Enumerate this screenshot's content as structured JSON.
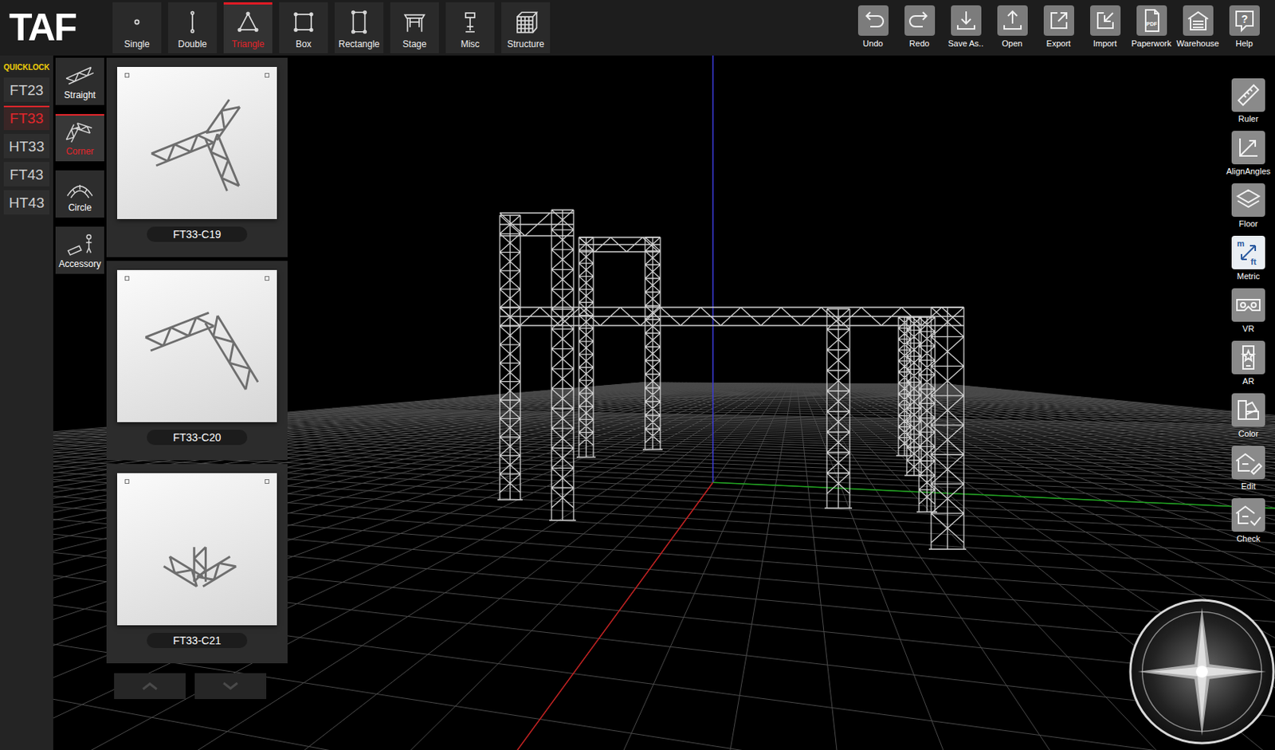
{
  "logo": {
    "text": "TAF"
  },
  "toolbar": {
    "tools": [
      {
        "label": "Single",
        "selected": false
      },
      {
        "label": "Double",
        "selected": false
      },
      {
        "label": "Triangle",
        "selected": true
      },
      {
        "label": "Box",
        "selected": false
      },
      {
        "label": "Rectangle",
        "selected": false
      },
      {
        "label": "Stage",
        "selected": false
      },
      {
        "label": "Misc",
        "selected": false
      },
      {
        "label": "Structure",
        "selected": false
      }
    ],
    "actions": [
      {
        "label": "Undo"
      },
      {
        "label": "Redo"
      },
      {
        "label": "Save As.."
      },
      {
        "label": "Open"
      },
      {
        "label": "Export"
      },
      {
        "label": "Import"
      },
      {
        "label": "Paperwork",
        "icon_text": "PDF"
      },
      {
        "label": "Warehouse"
      },
      {
        "label": "Help",
        "icon_text": "?"
      }
    ]
  },
  "quicklock": {
    "title": "QUICKLOCK",
    "series": [
      {
        "label": "FT23",
        "selected": false
      },
      {
        "label": "FT33",
        "selected": true
      },
      {
        "label": "HT33",
        "selected": false
      },
      {
        "label": "FT43",
        "selected": false
      },
      {
        "label": "HT43",
        "selected": false
      }
    ]
  },
  "categories": [
    {
      "label": "Straight",
      "selected": false
    },
    {
      "label": "Corner",
      "selected": true
    },
    {
      "label": "Circle",
      "selected": false
    },
    {
      "label": "Accessory",
      "selected": false
    }
  ],
  "products": [
    {
      "label": "FT33-C19"
    },
    {
      "label": "FT33-C20"
    },
    {
      "label": "FT33-C21"
    }
  ],
  "side_tools": [
    {
      "label": "Ruler",
      "selected": false
    },
    {
      "label": "AlignAngles",
      "selected": false
    },
    {
      "label": "Floor",
      "selected": false
    },
    {
      "label": "Metric",
      "selected": true,
      "icon_text": [
        "m",
        "ft"
      ]
    },
    {
      "label": "VR",
      "selected": false
    },
    {
      "label": "AR",
      "selected": false
    },
    {
      "label": "Color",
      "selected": false
    },
    {
      "label": "Edit",
      "selected": false
    },
    {
      "label": "Check",
      "selected": false
    }
  ]
}
